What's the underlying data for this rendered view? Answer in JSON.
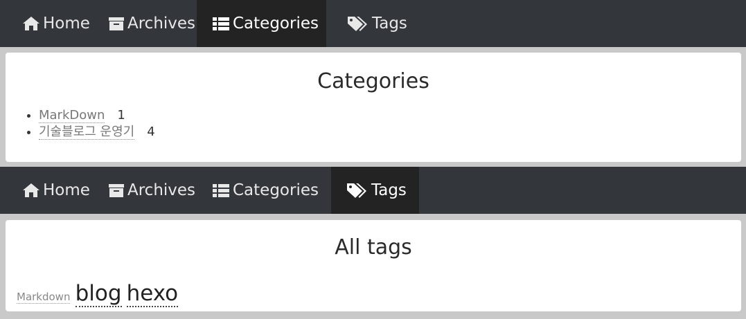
{
  "nav_top": {
    "items": [
      {
        "label": "Home",
        "icon": "home-icon"
      },
      {
        "label": "Archives",
        "icon": "archive-icon"
      },
      {
        "label": "Categories",
        "icon": "list-icon",
        "active": true
      },
      {
        "label": "Tags",
        "icon": "tags-icon"
      }
    ]
  },
  "categories_panel": {
    "title": "Categories",
    "items": [
      {
        "name": "MarkDown",
        "count": "1"
      },
      {
        "name": "기술블로그 운영기",
        "count": "4"
      }
    ]
  },
  "nav_bottom": {
    "items": [
      {
        "label": "Home",
        "icon": "home-icon"
      },
      {
        "label": "Archives",
        "icon": "archive-icon"
      },
      {
        "label": "Categories",
        "icon": "list-icon"
      },
      {
        "label": "Tags",
        "icon": "tags-icon",
        "active": true
      }
    ]
  },
  "tags_panel": {
    "title": "All tags",
    "tags": [
      {
        "name": "Markdown",
        "size": "small"
      },
      {
        "name": "blog",
        "size": "large"
      },
      {
        "name": "hexo",
        "size": "large"
      }
    ]
  },
  "colors": {
    "nav_bg": "#33363b",
    "nav_active_bg": "#232323",
    "page_bg": "#c9c9c9"
  }
}
